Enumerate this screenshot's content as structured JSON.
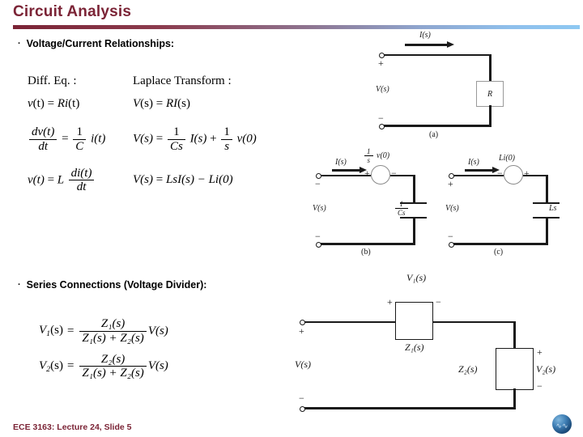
{
  "slide": {
    "title": "Circuit Analysis",
    "footer": "ECE 3163: Lecture 24, Slide 5",
    "accent_color": "#7b2436",
    "rule_gradient_from": "#7b2436",
    "rule_gradient_to": "#8ec8f2",
    "logo_name": "globe-waveform-logo"
  },
  "bullets": {
    "bullet_char": "·",
    "vcr": "Voltage/Current Relationships:",
    "series": "Series Connections (Voltage Divider):"
  },
  "equations": {
    "header_left": "Diff. Eq. :",
    "header_right": "Laplace Transform :",
    "resistor": {
      "time": {
        "v": "v",
        "t1": "(t)",
        "eq": "=",
        "R": "R",
        "i": "i",
        "t2": "(t)"
      },
      "laplace": {
        "V": "V",
        "s1": "(s)",
        "eq": "=",
        "R": "R",
        "I": "I",
        "s2": "(s)"
      }
    },
    "capacitor": {
      "time_num": "dv(t)",
      "time_den": "dt",
      "time_eq": "=",
      "time_frac_num": "1",
      "time_frac_den": "C",
      "time_tail": "i(t)",
      "lap_lhs": "V(s)",
      "lap_eq": "=",
      "lap_f1_num": "1",
      "lap_f1_den": "Cs",
      "lap_t1": "I(s)",
      "lap_plus": "+",
      "lap_f2_num": "1",
      "lap_f2_den": "s",
      "lap_t2": "v(0)"
    },
    "inductor": {
      "time_lhs": "v(t)",
      "time_eq": "=",
      "time_L": "L",
      "time_num": "di(t)",
      "time_den": "dt",
      "lap_lhs": "V(s)",
      "lap_eq": "=",
      "lap_rhs": "LsI(s) − Li(0)"
    }
  },
  "divider_equations": {
    "v1": {
      "lhs_V": "V",
      "lhs_sub": "1",
      "lhs_s": "(s)",
      "eq": "=",
      "num": "Z₁(s)",
      "den": "Z₁(s) + Z₂(s)",
      "tail": "V(s)"
    },
    "v2": {
      "lhs_V": "V",
      "lhs_sub": "2",
      "lhs_s": "(s)",
      "eq": "=",
      "num": "Z₂(s)",
      "den": "Z₁(s) + Z₂(s)",
      "tail": "V(s)"
    }
  },
  "circuit_a": {
    "caption": "(a)",
    "current_label": "I(s)",
    "source_label": "V(s)",
    "plus": "+",
    "minus": "−",
    "element_label": "R"
  },
  "circuit_b": {
    "caption": "(b)",
    "current_label": "I(s)",
    "source_label": "V(s)",
    "plus": "+",
    "minus": "−",
    "src_num": "1",
    "src_den": "s",
    "src_tail": "v(0)",
    "src_plus": "+",
    "src_minus": "−",
    "elem_num": "1",
    "elem_den": "Cs"
  },
  "circuit_c": {
    "caption": "(c)",
    "current_label": "I(s)",
    "source_label": "V(s)",
    "plus": "+",
    "minus": "−",
    "src_label": "Li(0)",
    "src_minus": "−",
    "src_plus": "+",
    "element_label": "Ls"
  },
  "circuit_divider": {
    "source_label": "V(s)",
    "plus": "+",
    "minus": "−",
    "v1_label": "V₁(s)",
    "z1_label": "Z₁(s)",
    "z2_label": "Z₂(s)",
    "v2_label": "V₂(s)",
    "z1_plus": "+",
    "z1_minus": "−",
    "z2_plus": "+",
    "z2_minus": "−"
  }
}
